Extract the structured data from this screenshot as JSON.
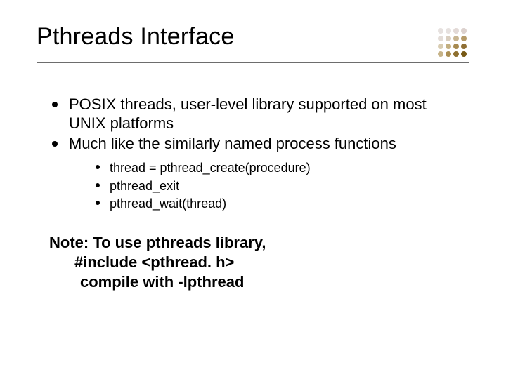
{
  "title": "Pthreads Interface",
  "bullets": [
    "POSIX threads, user-level library supported on most UNIX platforms",
    "Much like the similarly named process functions"
  ],
  "sub_bullets": [
    "thread = pthread_create(procedure)",
    "pthread_exit",
    "pthread_wait(thread)"
  ],
  "note": {
    "line1": "Note: To use pthreads library,",
    "line2": "#include <pthread. h>",
    "line3": "compile with -lpthread"
  },
  "dot_colors": [
    "#e6e1df",
    "#e6e1df",
    "#e2d9d6",
    "#dcd1cd",
    "#e3dcd7",
    "#d9cebf",
    "#c8b591",
    "#b59a68",
    "#d8ccb1",
    "#c3af80",
    "#a78a50",
    "#8f6f34",
    "#c6b388",
    "#aa8e53",
    "#8e7030",
    "#775915"
  ]
}
